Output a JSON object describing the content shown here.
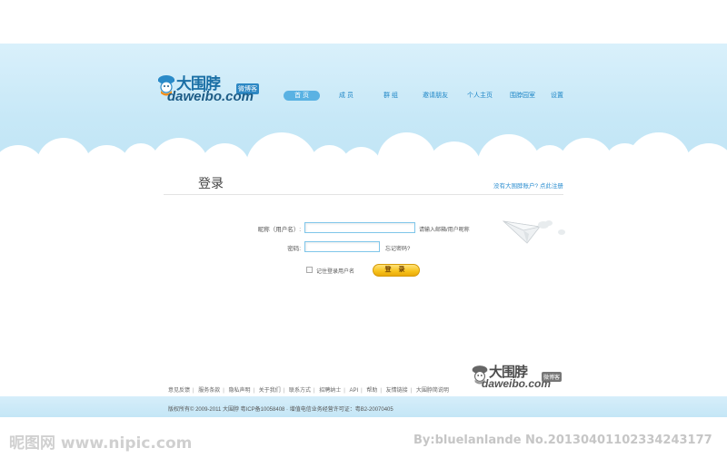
{
  "header": {
    "logo_cn": "大围脖",
    "logo_badge": "微博客",
    "logo_en": "daweibo.com",
    "nav": [
      {
        "label": "首 页",
        "active": true
      },
      {
        "label": "成 员",
        "active": false
      },
      {
        "label": "群 组",
        "active": false
      },
      {
        "label": "邀请朋友",
        "active": false
      },
      {
        "label": "个人主页",
        "active": false
      },
      {
        "label": "围脖园室",
        "active": false
      },
      {
        "label": "设置",
        "active": false
      }
    ]
  },
  "login": {
    "title": "登录",
    "register_link": "没有大围脖账户? 点此注册",
    "username_label": "昵称（用户名）:",
    "username_value": "",
    "username_hint": "请输入邮箱/用户昵称",
    "password_label": "密码:",
    "password_value": "",
    "forgot_link": "忘记密码?",
    "remember_label": "记住登录用户名",
    "submit_label": "登 录"
  },
  "footer": {
    "logo_cn": "大围脖",
    "logo_badge": "微博客",
    "logo_en": "daweibo.com",
    "links": [
      "意见反馈",
      "服务条款",
      "隐私声明",
      "关于我们",
      "联系方式",
      "招聘纳士",
      "API",
      "帮助",
      "友情链接",
      "大围脖简说明"
    ],
    "copyright": "版权所有© 2009-2011  大围脖  粤ICP备10058408 · 增值电信业务经营许可证：粤B2-20070405"
  },
  "watermark": {
    "left": "昵图网 www.nipic.com",
    "right": "By:bluelanlande  No.20130401102334243177"
  },
  "colors": {
    "accent": "#1e86c6",
    "sky": "#c7e8f7",
    "button": "#f7c21a"
  }
}
